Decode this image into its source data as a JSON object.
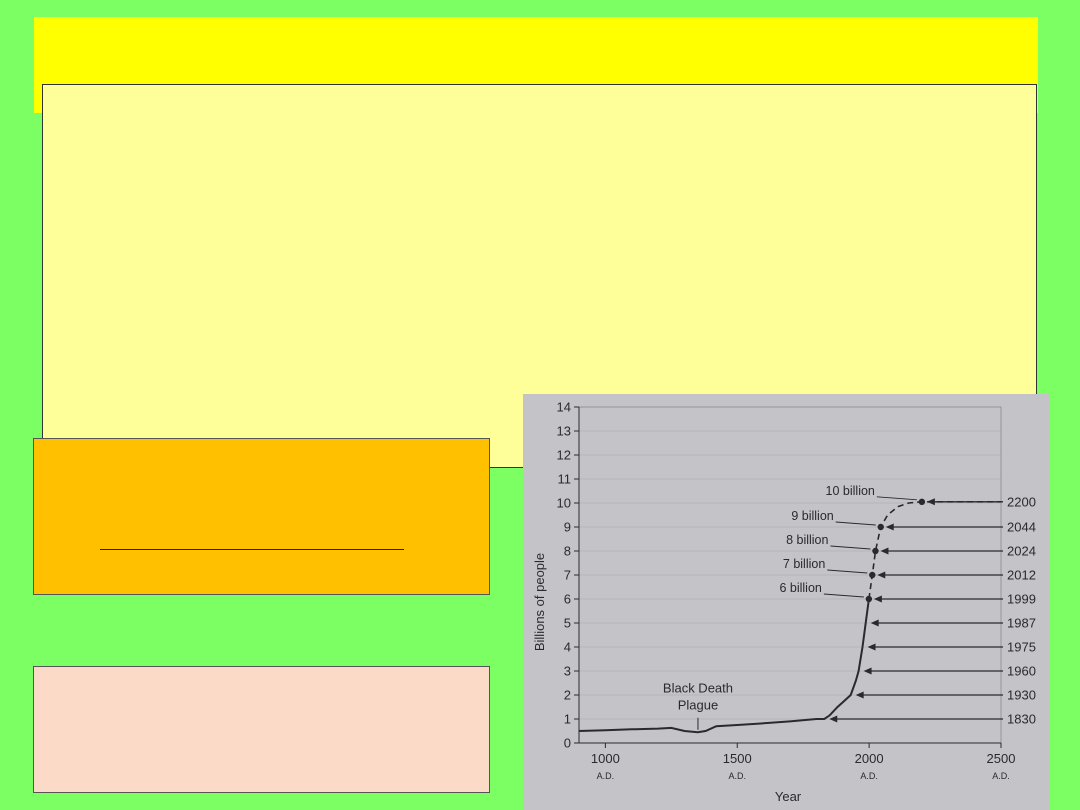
{
  "chart_data": {
    "type": "line",
    "title": "",
    "xlabel": "Year",
    "ylabel": "Billions of people",
    "xlim": [
      900,
      2500
    ],
    "ylim": [
      0,
      14
    ],
    "yticks": [
      0,
      1,
      2,
      3,
      4,
      5,
      6,
      7,
      8,
      9,
      10,
      11,
      12,
      13,
      14
    ],
    "xticks": [
      {
        "value": 1000,
        "label": "1000",
        "era": "A.D."
      },
      {
        "value": 1500,
        "label": "1500",
        "era": "A.D."
      },
      {
        "value": 2000,
        "label": "2000",
        "era": "A.D."
      },
      {
        "value": 2500,
        "label": "2500",
        "era": "A.D."
      }
    ],
    "grid": "horizontal",
    "series": [
      {
        "style": "solid",
        "points": [
          [
            900,
            0.5
          ],
          [
            1000,
            0.53
          ],
          [
            1100,
            0.57
          ],
          [
            1200,
            0.6
          ],
          [
            1250,
            0.63
          ],
          [
            1300,
            0.5
          ],
          [
            1350,
            0.45
          ],
          [
            1380,
            0.5
          ],
          [
            1420,
            0.7
          ],
          [
            1500,
            0.75
          ],
          [
            1600,
            0.82
          ],
          [
            1700,
            0.9
          ],
          [
            1800,
            1.0
          ],
          [
            1830,
            1.0
          ],
          [
            1850,
            1.15
          ],
          [
            1880,
            1.5
          ],
          [
            1900,
            1.7
          ],
          [
            1930,
            2.0
          ],
          [
            1950,
            2.6
          ],
          [
            1960,
            3.0
          ],
          [
            1975,
            4.0
          ],
          [
            1987,
            5.0
          ],
          [
            1999,
            6.0
          ]
        ]
      },
      {
        "style": "dashed",
        "points": [
          [
            1999,
            6.0
          ],
          [
            2012,
            7.0
          ],
          [
            2024,
            8.0
          ],
          [
            2044,
            9.0
          ],
          [
            2070,
            9.5
          ],
          [
            2110,
            9.85
          ],
          [
            2150,
            10.0
          ],
          [
            2200,
            10.05
          ],
          [
            2230,
            10.05
          ],
          [
            2500,
            10.05
          ]
        ]
      }
    ],
    "markers": [
      {
        "label": "6 billion",
        "year": 1999,
        "value": 6
      },
      {
        "label": "7 billion",
        "year": 2012,
        "value": 7
      },
      {
        "label": "8 billion",
        "year": 2024,
        "value": 8
      },
      {
        "label": "9 billion",
        "year": 2044,
        "value": 9
      },
      {
        "label": "10 billion",
        "year": 2200,
        "value": 10.05
      }
    ],
    "milestones": [
      {
        "year": "1830",
        "value": 1
      },
      {
        "year": "1930",
        "value": 2
      },
      {
        "year": "1960",
        "value": 3
      },
      {
        "year": "1975",
        "value": 4
      },
      {
        "year": "1987",
        "value": 5
      },
      {
        "year": "1999",
        "value": 6
      },
      {
        "year": "2012",
        "value": 7
      },
      {
        "year": "2024",
        "value": 8
      },
      {
        "year": "2044",
        "value": 9
      },
      {
        "year": "2200",
        "value": 10.05
      }
    ],
    "annotations": [
      {
        "text_line1": "Black Death",
        "text_line2": "Plague",
        "year": 1370
      }
    ]
  },
  "colors": {
    "background": "#7cff62",
    "title_band": "#ffff00",
    "main_panel": "#ffff99",
    "orange_box": "#ffc000",
    "peach_box": "#fbdbc8",
    "chart_bg": "#c4c4c8",
    "ink": "#2a2a2e"
  }
}
